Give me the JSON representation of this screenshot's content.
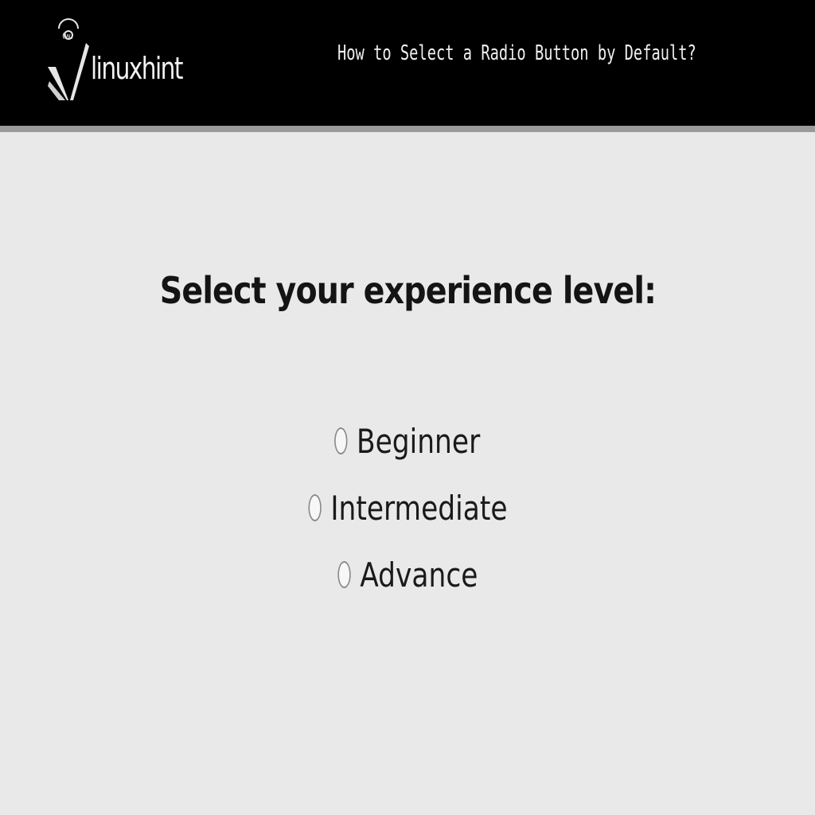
{
  "header": {
    "logo_text": "linuxhint",
    "logo_icon": "linuxhint-logo-icon",
    "title": "How to Select a Radio Button by Default?",
    "background": "#000000"
  },
  "main": {
    "heading": "Select your experience level:",
    "options": [
      {
        "label": "Beginner",
        "checked": false
      },
      {
        "label": "Intermediate",
        "checked": false
      },
      {
        "label": "Advance",
        "checked": false
      }
    ],
    "background": "#e9e9e9"
  }
}
